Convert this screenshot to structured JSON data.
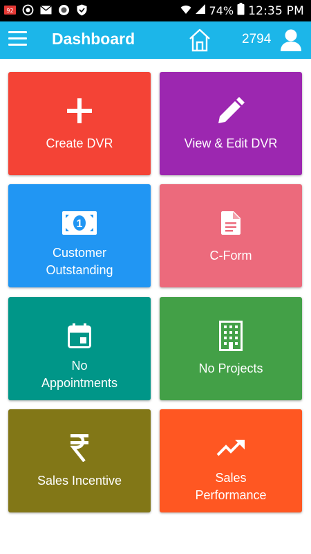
{
  "status_bar": {
    "battery": "74%",
    "time": "12:35 PM",
    "notification_badge": "92"
  },
  "app_bar": {
    "title": "Dashboard",
    "count": "2794",
    "color": "#1cb6e9"
  },
  "tiles": [
    {
      "label": "Create DVR",
      "icon": "plus-icon",
      "color": "#f44336"
    },
    {
      "label": "View & Edit DVR",
      "icon": "pencil-icon",
      "color": "#9c27b0"
    },
    {
      "label": "Customer\nOutstanding",
      "icon": "money-icon",
      "color": "#2196f3"
    },
    {
      "label": "C-Form",
      "icon": "document-icon",
      "color": "#ec6a7c"
    },
    {
      "label": "No\nAppointments",
      "icon": "calendar-icon",
      "color": "#009688"
    },
    {
      "label": "No Projects",
      "icon": "building-icon",
      "color": "#43a047"
    },
    {
      "label": "Sales Incentive",
      "icon": "rupee-icon",
      "color": "#827717"
    },
    {
      "label": "Sales\nPerformance",
      "icon": "trending-up-icon",
      "color": "#ff5722"
    }
  ]
}
